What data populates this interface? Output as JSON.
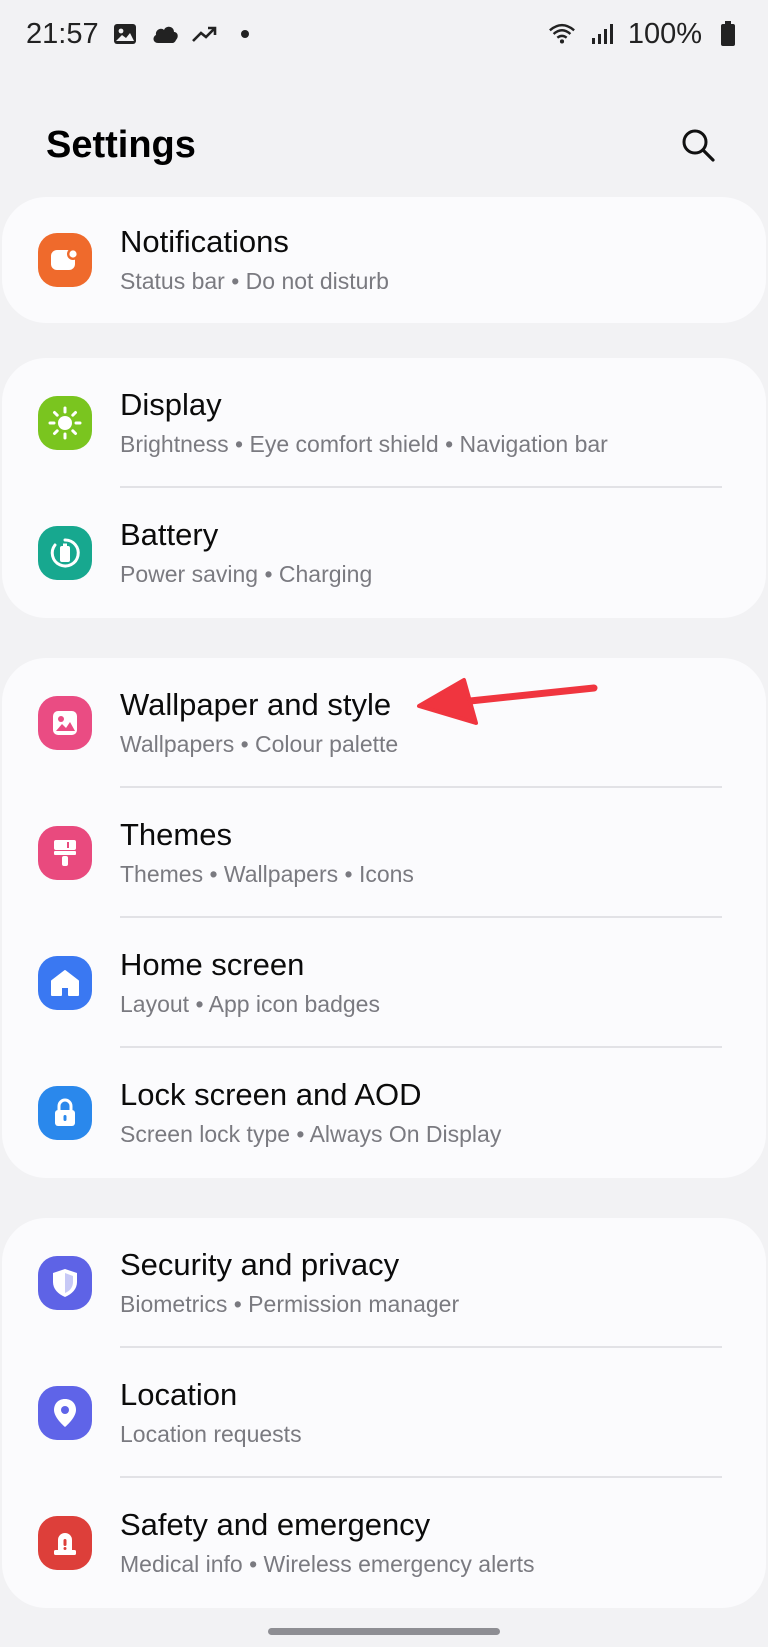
{
  "status_bar": {
    "time": "21:57",
    "left_icons": [
      "image-icon",
      "cloud-icon",
      "trending-up-icon",
      "dot-icon"
    ],
    "battery_percent": "100%",
    "right_icons": [
      "wifi-icon",
      "signal-icon",
      "battery-icon"
    ]
  },
  "header": {
    "title": "Settings",
    "search_icon": "search-icon"
  },
  "groups": [
    {
      "items": [
        {
          "id": "notifications",
          "title": "Notifications",
          "subtitle": "Status bar  •  Do not disturb",
          "icon": "notification-icon",
          "color": "#ef6a2c"
        }
      ]
    },
    {
      "items": [
        {
          "id": "display",
          "title": "Display",
          "subtitle": "Brightness  •  Eye comfort shield  •  Navigation bar",
          "icon": "sun-icon",
          "color": "#7ac51f"
        },
        {
          "id": "battery",
          "title": "Battery",
          "subtitle": "Power saving  •  Charging",
          "icon": "battery-care-icon",
          "color": "#17a88f"
        }
      ]
    },
    {
      "items": [
        {
          "id": "wallpaper",
          "title": "Wallpaper and style",
          "subtitle": "Wallpapers  •  Colour palette",
          "icon": "wallpaper-icon",
          "color": "#ea4c83"
        },
        {
          "id": "themes",
          "title": "Themes",
          "subtitle": "Themes  •  Wallpapers  •  Icons",
          "icon": "brush-icon",
          "color": "#e94a7e"
        },
        {
          "id": "home",
          "title": "Home screen",
          "subtitle": "Layout  •  App icon badges",
          "icon": "home-icon",
          "color": "#3a78f2"
        },
        {
          "id": "lock",
          "title": "Lock screen and AOD",
          "subtitle": "Screen lock type  •  Always On Display",
          "icon": "lock-icon",
          "color": "#2a88ec"
        }
      ]
    },
    {
      "items": [
        {
          "id": "security",
          "title": "Security and privacy",
          "subtitle": "Biometrics  •  Permission manager",
          "icon": "shield-icon",
          "color": "#5e63e6"
        },
        {
          "id": "location",
          "title": "Location",
          "subtitle": "Location requests",
          "icon": "location-pin-icon",
          "color": "#5f64e8"
        },
        {
          "id": "safety",
          "title": "Safety and emergency",
          "subtitle": "Medical info  •  Wireless emergency alerts",
          "icon": "emergency-icon",
          "color": "#dd3f3a"
        }
      ]
    }
  ],
  "annotation": {
    "arrow_color": "#f0353f"
  }
}
